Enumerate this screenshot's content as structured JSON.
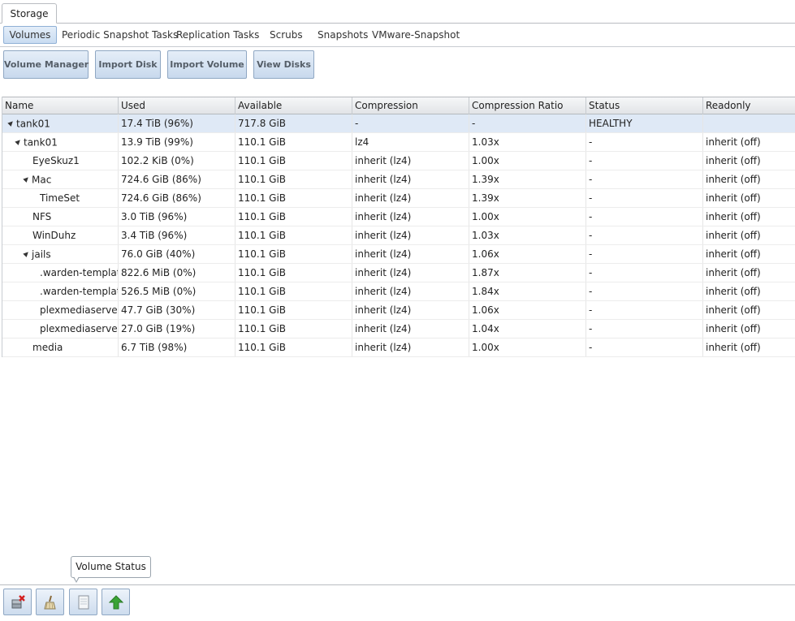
{
  "top_tab": "Storage",
  "sub_tabs": [
    "Volumes",
    "Periodic Snapshot Tasks",
    "Replication Tasks",
    "Scrubs",
    "Snapshots",
    "VMware-Snapshot"
  ],
  "toolbar": [
    "Volume Manager",
    "Import Disk",
    "Import Volume",
    "View Disks"
  ],
  "columns": [
    "Name",
    "Used",
    "Available",
    "Compression",
    "Compression Ratio",
    "Status",
    "Readonly"
  ],
  "rows": [
    {
      "name": "tank01",
      "expander": "▲",
      "used": "17.4 TiB (96%)",
      "available": "717.8 GiB",
      "compression": "-",
      "ratio": "-",
      "status": "HEALTHY",
      "readonly": ""
    },
    {
      "name": "tank01",
      "expander": "▲",
      "used": "13.9 TiB (99%)",
      "available": "110.1 GiB",
      "compression": "lz4",
      "ratio": "1.03x",
      "status": "-",
      "readonly": "inherit (off)"
    },
    {
      "name": "EyeSkuz1",
      "expander": "",
      "used": "102.2 KiB (0%)",
      "available": "110.1 GiB",
      "compression": "inherit (lz4)",
      "ratio": "1.00x",
      "status": "-",
      "readonly": "inherit (off)"
    },
    {
      "name": "Mac",
      "expander": "▲",
      "used": "724.6 GiB (86%)",
      "available": "110.1 GiB",
      "compression": "inherit (lz4)",
      "ratio": "1.39x",
      "status": "-",
      "readonly": "inherit (off)"
    },
    {
      "name": "TimeSet",
      "expander": "",
      "used": "724.6 GiB (86%)",
      "available": "110.1 GiB",
      "compression": "inherit (lz4)",
      "ratio": "1.39x",
      "status": "-",
      "readonly": "inherit (off)"
    },
    {
      "name": "NFS",
      "expander": "",
      "used": "3.0 TiB (96%)",
      "available": "110.1 GiB",
      "compression": "inherit (lz4)",
      "ratio": "1.00x",
      "status": "-",
      "readonly": "inherit (off)"
    },
    {
      "name": "WinDuhz",
      "expander": "",
      "used": "3.4 TiB (96%)",
      "available": "110.1 GiB",
      "compression": "inherit (lz4)",
      "ratio": "1.03x",
      "status": "-",
      "readonly": "inherit (off)"
    },
    {
      "name": "jails",
      "expander": "▲",
      "used": "76.0 GiB (40%)",
      "available": "110.1 GiB",
      "compression": "inherit (lz4)",
      "ratio": "1.06x",
      "status": "-",
      "readonly": "inherit (off)"
    },
    {
      "name": ".warden-template",
      "expander": "",
      "used": "822.6 MiB (0%)",
      "available": "110.1 GiB",
      "compression": "inherit (lz4)",
      "ratio": "1.87x",
      "status": "-",
      "readonly": "inherit (off)"
    },
    {
      "name": ".warden-template",
      "expander": "",
      "used": "526.5 MiB (0%)",
      "available": "110.1 GiB",
      "compression": "inherit (lz4)",
      "ratio": "1.84x",
      "status": "-",
      "readonly": "inherit (off)"
    },
    {
      "name": "plexmediaserver_",
      "expander": "",
      "used": "47.7 GiB (30%)",
      "available": "110.1 GiB",
      "compression": "inherit (lz4)",
      "ratio": "1.06x",
      "status": "-",
      "readonly": "inherit (off)"
    },
    {
      "name": "plexmediaserver_",
      "expander": "",
      "used": "27.0 GiB (19%)",
      "available": "110.1 GiB",
      "compression": "inherit (lz4)",
      "ratio": "1.04x",
      "status": "-",
      "readonly": "inherit (off)"
    },
    {
      "name": "media",
      "expander": "",
      "used": "6.7 TiB (98%)",
      "available": "110.1 GiB",
      "compression": "inherit (lz4)",
      "ratio": "1.00x",
      "status": "-",
      "readonly": "inherit (off)"
    }
  ],
  "tooltip": "Volume Status",
  "bottom_icons": [
    "detach-volume-icon",
    "scrub-volume-icon",
    "volume-status-icon",
    "upgrade-volume-icon"
  ],
  "colors": {
    "accent": "#c9dcf1",
    "selected_row": "#dfe9f6",
    "upgrade_green": "#3aa335",
    "detach_red": "#d42020"
  }
}
